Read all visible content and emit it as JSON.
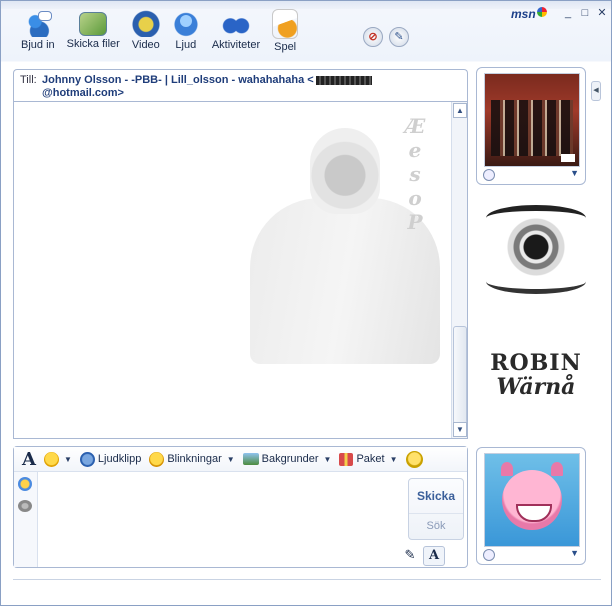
{
  "brand": {
    "name": "msn"
  },
  "window_controls": {
    "minimize": "_",
    "maximize": "□",
    "close": "✕"
  },
  "toolbar": {
    "items": [
      {
        "label": "Bjud in",
        "icon": "invite-icon"
      },
      {
        "label": "Skicka filer",
        "icon": "send-files-icon"
      },
      {
        "label": "Video",
        "icon": "video-icon"
      },
      {
        "label": "Ljud",
        "icon": "voice-icon"
      },
      {
        "label": "Aktiviteter",
        "icon": "activities-icon"
      },
      {
        "label": "Spel",
        "icon": "games-icon"
      }
    ],
    "block_icon": "⊘",
    "pen_icon": "✎"
  },
  "conversation": {
    "to_label": "Till:",
    "to_names": "Johnny Olsson - -PBB- | Lill_olsson - wahahahaha <",
    "to_email_suffix": "@hotmail.com>",
    "wallpaper_letters": "Æ\ne\ns\no\nP"
  },
  "composer": {
    "font_label": "A",
    "emoticon_label": "",
    "voice_clip_label": "Ljudklipp",
    "winks_label": "Blinkningar",
    "backgrounds_label": "Bakgrunder",
    "packages_label": "Paket",
    "send_label": "Skicka",
    "search_label": "Sök",
    "handwrite_icon": "✎",
    "type_icon": "A"
  },
  "contact_cards": {
    "robin_line1": "ROBIN",
    "robin_line2": "Wärnå"
  },
  "colors": {
    "accent": "#1f3d7a",
    "border": "#a9b8d3",
    "send_text": "#3a5f9a"
  }
}
